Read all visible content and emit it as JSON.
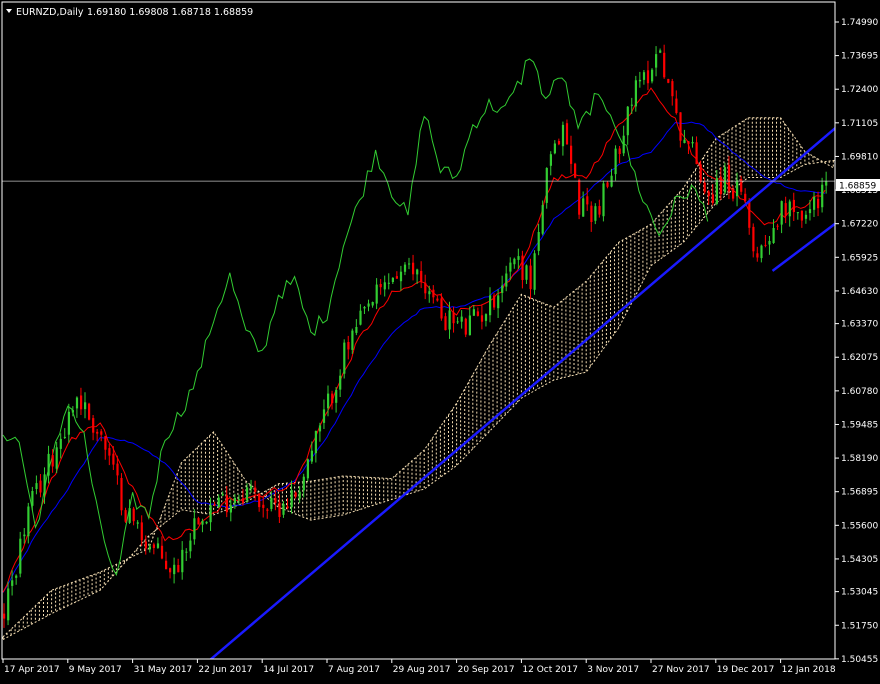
{
  "header": {
    "symbol_label": "EURNZD,Daily",
    "ohlc_label": "1.69180 1.69808 1.68718 1.68859"
  },
  "colors": {
    "background": "#000000",
    "axis": "#ffffff",
    "bull": "#32cd32",
    "bear": "#ff0000",
    "tenkan": "#ff0000",
    "kijun": "#0000ff",
    "chikou": "#32cd32",
    "cloud": "#f5deb3",
    "trendline": "#1a1aff",
    "price_line": "#c0c0c0"
  },
  "chart_data": {
    "type": "candlestick",
    "y_axis": {
      "min": 1.5045,
      "max": 1.7576,
      "tick_labels": [
        "1.74990",
        "1.73695",
        "1.72400",
        "1.71105",
        "1.69810",
        "1.68515",
        "1.67220",
        "1.65925",
        "1.64630",
        "1.63370",
        "1.62075",
        "1.60780",
        "1.59485",
        "1.58190",
        "1.56895",
        "1.55600",
        "1.54305",
        "1.53045",
        "1.51750",
        "1.50455"
      ]
    },
    "current_price_label": "1.68859",
    "current_price": 1.68859,
    "x_axis": {
      "tick_labels": [
        "17 Apr 2017",
        "9 May 2017",
        "31 May 2017",
        "22 Jun 2017",
        "14 Jul 2017",
        "7 Aug 2017",
        "29 Aug 2017",
        "20 Sep 2017",
        "12 Oct 2017",
        "3 Nov 2017",
        "27 Nov 2017",
        "19 Dec 2017",
        "12 Jan 2018"
      ],
      "tick_index": [
        0,
        16,
        32,
        48,
        64,
        80,
        96,
        112,
        128,
        144,
        160,
        176,
        192
      ],
      "bar_count": 204
    },
    "price_path_anchors": [
      [
        0,
        1.522
      ],
      [
        6,
        1.561
      ],
      [
        12,
        1.583
      ],
      [
        18,
        1.606
      ],
      [
        24,
        1.59
      ],
      [
        30,
        1.562
      ],
      [
        36,
        1.548
      ],
      [
        42,
        1.538
      ],
      [
        48,
        1.561
      ],
      [
        54,
        1.565
      ],
      [
        60,
        1.57
      ],
      [
        66,
        1.562
      ],
      [
        72,
        1.568
      ],
      [
        78,
        1.593
      ],
      [
        84,
        1.622
      ],
      [
        90,
        1.64
      ],
      [
        96,
        1.652
      ],
      [
        102,
        1.654
      ],
      [
        108,
        1.637
      ],
      [
        114,
        1.632
      ],
      [
        120,
        1.641
      ],
      [
        126,
        1.66
      ],
      [
        130,
        1.65
      ],
      [
        134,
        1.69
      ],
      [
        138,
        1.71
      ],
      [
        142,
        1.68
      ],
      [
        146,
        1.677
      ],
      [
        150,
        1.69
      ],
      [
        154,
        1.718
      ],
      [
        158,
        1.728
      ],
      [
        162,
        1.74
      ],
      [
        166,
        1.712
      ],
      [
        170,
        1.7
      ],
      [
        174,
        1.683
      ],
      [
        178,
        1.69
      ],
      [
        182,
        1.682
      ],
      [
        186,
        1.66
      ],
      [
        190,
        1.672
      ],
      [
        194,
        1.682
      ],
      [
        198,
        1.674
      ],
      [
        203,
        1.689
      ]
    ],
    "tenkan_anchors": [
      [
        0,
        1.53
      ],
      [
        8,
        1.558
      ],
      [
        16,
        1.588
      ],
      [
        24,
        1.595
      ],
      [
        32,
        1.57
      ],
      [
        40,
        1.55
      ],
      [
        48,
        1.555
      ],
      [
        56,
        1.566
      ],
      [
        64,
        1.568
      ],
      [
        72,
        1.572
      ],
      [
        80,
        1.6
      ],
      [
        88,
        1.628
      ],
      [
        96,
        1.645
      ],
      [
        104,
        1.65
      ],
      [
        112,
        1.638
      ],
      [
        120,
        1.641
      ],
      [
        128,
        1.656
      ],
      [
        136,
        1.69
      ],
      [
        144,
        1.69
      ],
      [
        152,
        1.71
      ],
      [
        160,
        1.725
      ],
      [
        166,
        1.712
      ],
      [
        172,
        1.694
      ],
      [
        180,
        1.686
      ],
      [
        188,
        1.672
      ],
      [
        196,
        1.678
      ],
      [
        203,
        1.684
      ]
    ],
    "kijun_anchors": [
      [
        0,
        1.53
      ],
      [
        8,
        1.552
      ],
      [
        16,
        1.57
      ],
      [
        24,
        1.59
      ],
      [
        32,
        1.588
      ],
      [
        40,
        1.58
      ],
      [
        48,
        1.565
      ],
      [
        56,
        1.563
      ],
      [
        64,
        1.566
      ],
      [
        72,
        1.573
      ],
      [
        80,
        1.59
      ],
      [
        88,
        1.612
      ],
      [
        96,
        1.63
      ],
      [
        104,
        1.64
      ],
      [
        112,
        1.64
      ],
      [
        120,
        1.644
      ],
      [
        128,
        1.655
      ],
      [
        136,
        1.674
      ],
      [
        144,
        1.684
      ],
      [
        152,
        1.695
      ],
      [
        160,
        1.7
      ],
      [
        166,
        1.711
      ],
      [
        172,
        1.711
      ],
      [
        180,
        1.7
      ],
      [
        188,
        1.69
      ],
      [
        196,
        1.685
      ],
      [
        203,
        1.684
      ]
    ],
    "chikou_anchors": [
      [
        0,
        1.592
      ],
      [
        4,
        1.588
      ],
      [
        8,
        1.555
      ],
      [
        12,
        1.58
      ],
      [
        16,
        1.604
      ],
      [
        20,
        1.59
      ],
      [
        24,
        1.555
      ],
      [
        28,
        1.535
      ],
      [
        32,
        1.566
      ],
      [
        36,
        1.56
      ],
      [
        40,
        1.59
      ],
      [
        44,
        1.6
      ],
      [
        48,
        1.613
      ],
      [
        52,
        1.636
      ],
      [
        56,
        1.652
      ],
      [
        60,
        1.63
      ],
      [
        64,
        1.622
      ],
      [
        68,
        1.645
      ],
      [
        72,
        1.65
      ],
      [
        76,
        1.63
      ],
      [
        80,
        1.638
      ],
      [
        84,
        1.664
      ],
      [
        88,
        1.681
      ],
      [
        92,
        1.7
      ],
      [
        96,
        1.685
      ],
      [
        100,
        1.675
      ],
      [
        104,
        1.716
      ],
      [
        108,
        1.693
      ],
      [
        112,
        1.69
      ],
      [
        116,
        1.71
      ],
      [
        120,
        1.718
      ],
      [
        124,
        1.716
      ],
      [
        128,
        1.728
      ],
      [
        130,
        1.738
      ],
      [
        134,
        1.72
      ],
      [
        138,
        1.73
      ],
      [
        142,
        1.708
      ],
      [
        146,
        1.72
      ],
      [
        150,
        1.716
      ],
      [
        154,
        1.7
      ],
      [
        158,
        1.682
      ],
      [
        162,
        1.668
      ],
      [
        166,
        1.68
      ],
      [
        170,
        1.686
      ],
      [
        174,
        1.676
      ]
    ],
    "cloud_a_anchors": [
      [
        0,
        1.512
      ],
      [
        12,
        1.522
      ],
      [
        24,
        1.531
      ],
      [
        36,
        1.552
      ],
      [
        44,
        1.562
      ],
      [
        52,
        1.56
      ],
      [
        60,
        1.565
      ],
      [
        68,
        1.572
      ],
      [
        76,
        1.573
      ],
      [
        84,
        1.575
      ],
      [
        96,
        1.574
      ],
      [
        104,
        1.585
      ],
      [
        112,
        1.603
      ],
      [
        120,
        1.625
      ],
      [
        128,
        1.645
      ],
      [
        136,
        1.64
      ],
      [
        144,
        1.65
      ],
      [
        152,
        1.665
      ],
      [
        160,
        1.672
      ],
      [
        168,
        1.686
      ],
      [
        176,
        1.705
      ],
      [
        184,
        1.713
      ],
      [
        192,
        1.713
      ],
      [
        198,
        1.7
      ],
      [
        207,
        1.692
      ]
    ],
    "cloud_b_anchors": [
      [
        0,
        1.513
      ],
      [
        12,
        1.531
      ],
      [
        24,
        1.538
      ],
      [
        36,
        1.547
      ],
      [
        44,
        1.58
      ],
      [
        52,
        1.592
      ],
      [
        60,
        1.573
      ],
      [
        68,
        1.563
      ],
      [
        76,
        1.558
      ],
      [
        84,
        1.56
      ],
      [
        96,
        1.566
      ],
      [
        104,
        1.57
      ],
      [
        112,
        1.579
      ],
      [
        120,
        1.592
      ],
      [
        128,
        1.605
      ],
      [
        136,
        1.612
      ],
      [
        144,
        1.615
      ],
      [
        152,
        1.632
      ],
      [
        160,
        1.656
      ],
      [
        168,
        1.665
      ],
      [
        176,
        1.68
      ],
      [
        184,
        1.69
      ],
      [
        192,
        1.69
      ],
      [
        198,
        1.695
      ],
      [
        207,
        1.697
      ]
    ],
    "trendlines": [
      {
        "p1": [
          48,
          1.5
        ],
        "p2": [
          207,
          1.711
        ]
      },
      {
        "p1": [
          190,
          1.654
        ],
        "p2": [
          207,
          1.674
        ]
      }
    ]
  }
}
